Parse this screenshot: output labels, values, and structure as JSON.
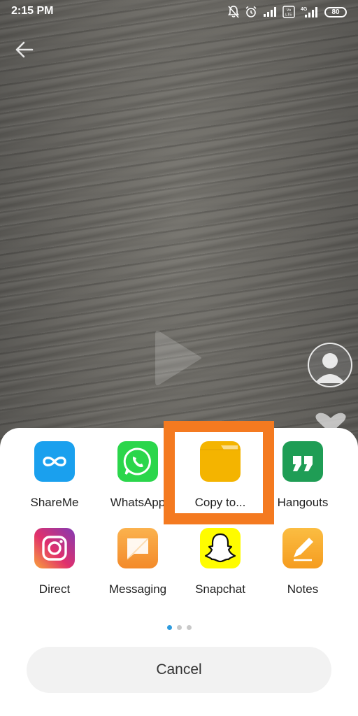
{
  "status_bar": {
    "time": "2:15 PM",
    "battery": "80",
    "network_label": "4G",
    "volte_label": "Vo LTE"
  },
  "share_apps": [
    {
      "label": "ShareMe",
      "icon": "shareme-icon",
      "color": "#1aa0ee"
    },
    {
      "label": "WhatsApp",
      "icon": "whatsapp-icon",
      "color": "#2bd64b"
    },
    {
      "label": "Copy to...",
      "icon": "folder-icon",
      "color": "#f4b400"
    },
    {
      "label": "Hangouts",
      "icon": "hangouts-icon",
      "color": "#1f9d55"
    },
    {
      "label": "Direct",
      "icon": "instagram-icon",
      "color": "#c13584"
    },
    {
      "label": "Messaging",
      "icon": "messaging-icon",
      "color": "#f59a3b"
    },
    {
      "label": "Snapchat",
      "icon": "snapchat-icon",
      "color": "#fffc00"
    },
    {
      "label": "Notes",
      "icon": "notes-icon",
      "color": "#f7a928"
    }
  ],
  "highlight_color": "#f47a20",
  "pagination": {
    "pages": 3,
    "active": 1
  },
  "cancel_label": "Cancel"
}
